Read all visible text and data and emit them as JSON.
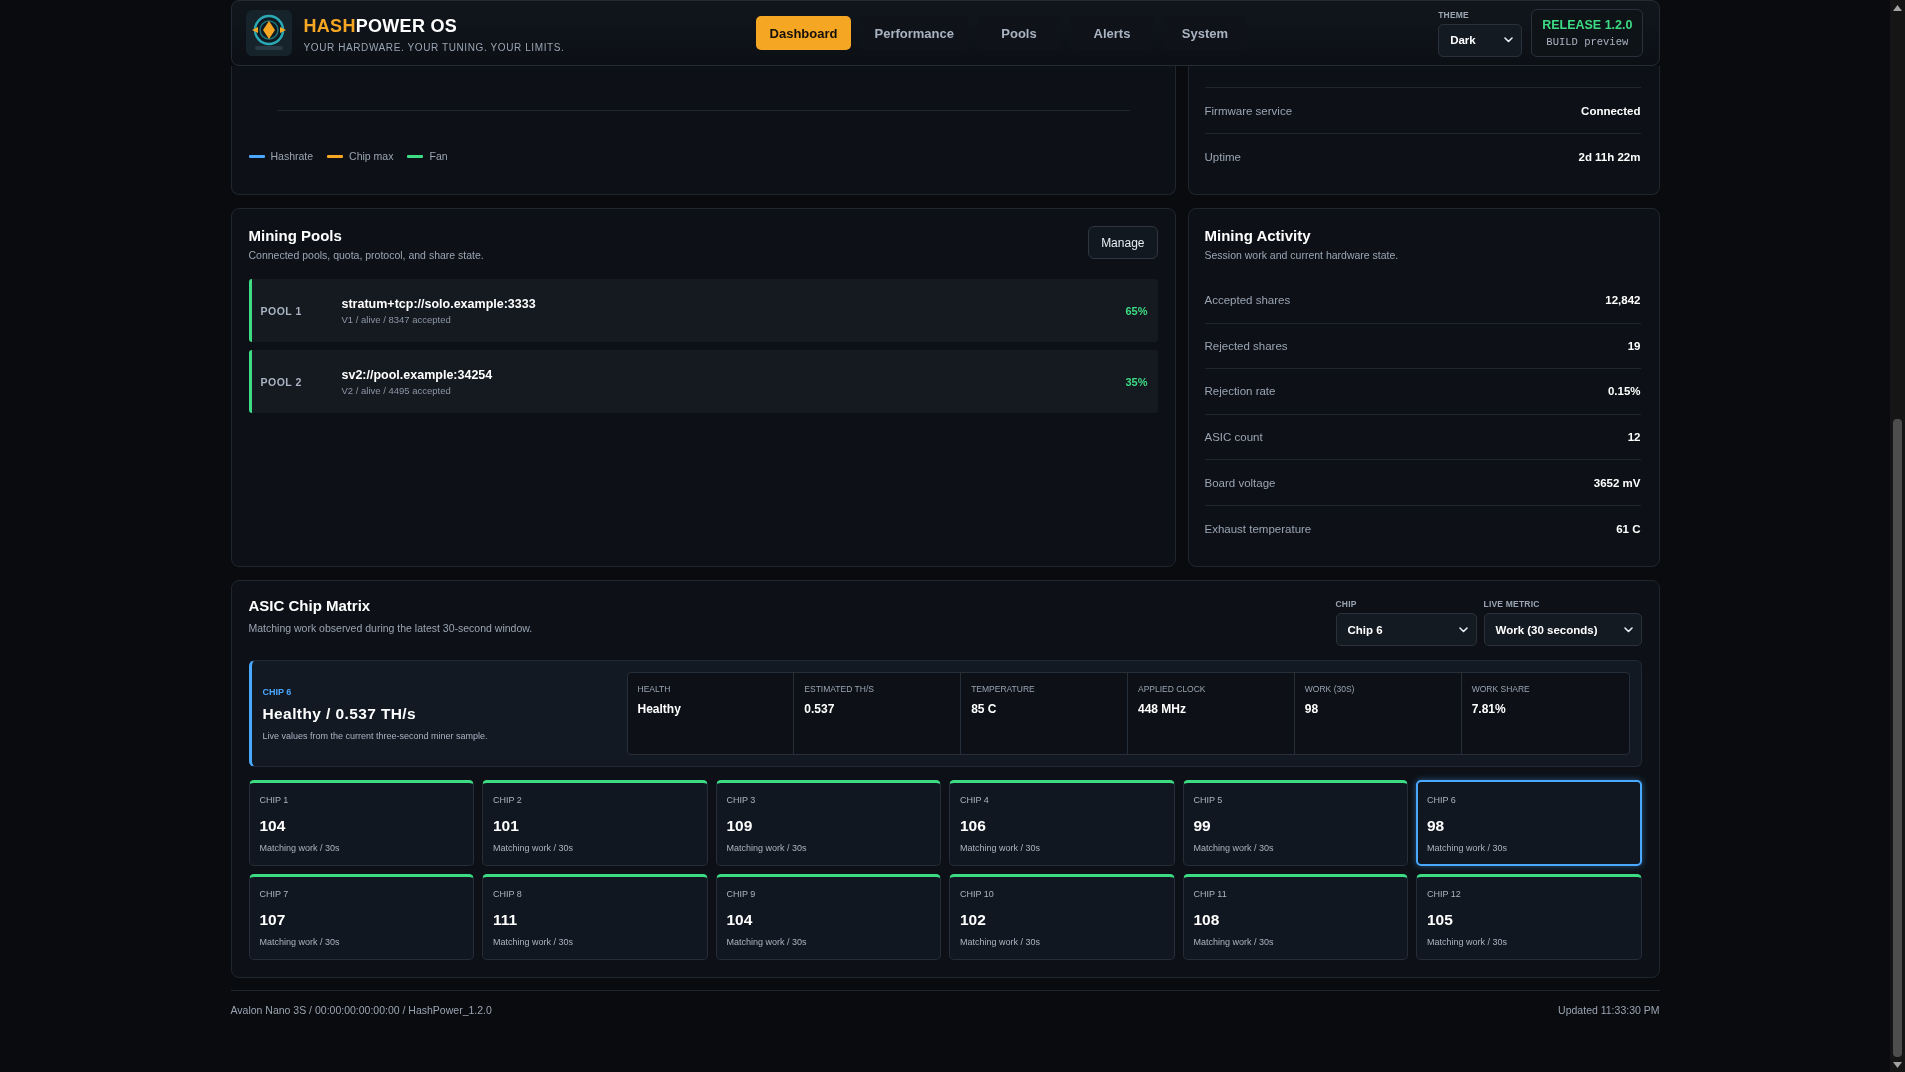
{
  "header": {
    "brand": {
      "accent": "HASH",
      "name": "POWER OS"
    },
    "tagline": "YOUR HARDWARE. YOUR TUNING. YOUR LIMITS.",
    "nav": [
      {
        "label": "Dashboard",
        "selected": true
      },
      {
        "label": "Performance",
        "selected": false
      },
      {
        "label": "Pools",
        "selected": false
      },
      {
        "label": "Alerts",
        "selected": false
      },
      {
        "label": "System",
        "selected": false
      }
    ],
    "theme": {
      "label": "THEME",
      "value": "Dark"
    },
    "release": {
      "version": "RELEASE 1.2.0",
      "build": "BUILD preview"
    }
  },
  "performance_chart": {
    "legend": [
      {
        "label": "Hashrate",
        "color": "#4aa8ff"
      },
      {
        "label": "Chip max",
        "color": "#f5a623"
      },
      {
        "label": "Fan",
        "color": "#3ddc84"
      }
    ]
  },
  "system_status": {
    "rows": [
      {
        "label": "Firmware service",
        "value": "Connected"
      },
      {
        "label": "Uptime",
        "value": "2d 11h 22m"
      }
    ]
  },
  "mining_pools": {
    "title": "Mining Pools",
    "subtitle": "Connected pools, quota, protocol, and share state.",
    "action": "Manage",
    "pools": [
      {
        "name": "POOL 1",
        "url": "stratum+tcp://solo.example:3333",
        "details": "V1 / alive / 8347 accepted",
        "quota": "65%"
      },
      {
        "name": "POOL 2",
        "url": "sv2://pool.example:34254",
        "details": "V2 / alive / 4495 accepted",
        "quota": "35%"
      }
    ]
  },
  "mining_activity": {
    "title": "Mining Activity",
    "subtitle": "Session work and current hardware state.",
    "rows": [
      {
        "label": "Accepted shares",
        "value": "12,842"
      },
      {
        "label": "Rejected shares",
        "value": "19"
      },
      {
        "label": "Rejection rate",
        "value": "0.15%"
      },
      {
        "label": "ASIC count",
        "value": "12"
      },
      {
        "label": "Board voltage",
        "value": "3652 mV"
      },
      {
        "label": "Exhaust temperature",
        "value": "61 C"
      }
    ]
  },
  "chip_matrix": {
    "title": "ASIC Chip Matrix",
    "subtitle": "Matching work observed during the latest 30-second window.",
    "chip_select": {
      "label": "CHIP",
      "value": "Chip 6"
    },
    "metric_select": {
      "label": "LIVE METRIC",
      "value": "Work (30 seconds)"
    },
    "detail": {
      "tag": "CHIP 6",
      "headline": "Healthy / 0.537 TH/s",
      "note": "Live values from the current three-second miner sample.",
      "stats": [
        {
          "label": "HEALTH",
          "value": "Healthy"
        },
        {
          "label": "ESTIMATED TH/S",
          "value": "0.537"
        },
        {
          "label": "TEMPERATURE",
          "value": "85 C"
        },
        {
          "label": "APPLIED CLOCK",
          "value": "448 MHz"
        },
        {
          "label": "WORK (30S)",
          "value": "98"
        },
        {
          "label": "WORK SHARE",
          "value": "7.81%"
        }
      ]
    },
    "chips": [
      {
        "label": "CHIP 1",
        "value": "104",
        "caption": "Matching work / 30s",
        "selected": false
      },
      {
        "label": "CHIP 2",
        "value": "101",
        "caption": "Matching work / 30s",
        "selected": false
      },
      {
        "label": "CHIP 3",
        "value": "109",
        "caption": "Matching work / 30s",
        "selected": false
      },
      {
        "label": "CHIP 4",
        "value": "106",
        "caption": "Matching work / 30s",
        "selected": false
      },
      {
        "label": "CHIP 5",
        "value": "99",
        "caption": "Matching work / 30s",
        "selected": false
      },
      {
        "label": "CHIP 6",
        "value": "98",
        "caption": "Matching work / 30s",
        "selected": true
      },
      {
        "label": "CHIP 7",
        "value": "107",
        "caption": "Matching work / 30s",
        "selected": false
      },
      {
        "label": "CHIP 8",
        "value": "111",
        "caption": "Matching work / 30s",
        "selected": false
      },
      {
        "label": "CHIP 9",
        "value": "104",
        "caption": "Matching work / 30s",
        "selected": false
      },
      {
        "label": "CHIP 10",
        "value": "102",
        "caption": "Matching work / 30s",
        "selected": false
      },
      {
        "label": "CHIP 11",
        "value": "108",
        "caption": "Matching work / 30s",
        "selected": false
      },
      {
        "label": "CHIP 12",
        "value": "105",
        "caption": "Matching work / 30s",
        "selected": false
      }
    ]
  },
  "footer": {
    "device": "Avalon Nano 3S / 00:00:00:00:00:00 / HashPower_1.2.0",
    "updated": "Updated 11:33:30 PM"
  }
}
